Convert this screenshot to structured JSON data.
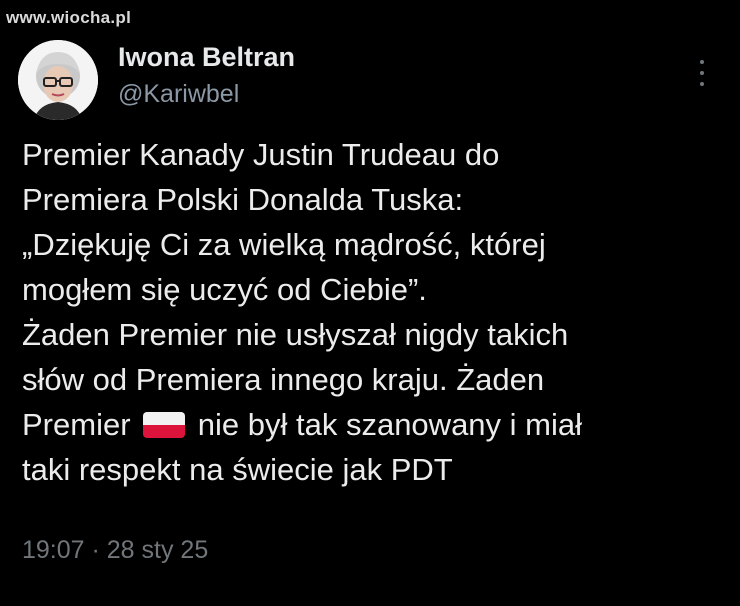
{
  "watermark": "www.wiocha.pl",
  "author": {
    "name": "Iwona Beltran",
    "handle": "@Kariwbel"
  },
  "tweet": {
    "line1": "Premier Kanady Justin Trudeau do",
    "line2": "Premiera Polski Donalda Tuska:",
    "line3": "„Dziękuję Ci za wielką mądrość, której",
    "line4": "mogłem się uczyć od Ciebie”.",
    "line5": "Żaden Premier nie usłyszał nigdy takich",
    "line6": "słów od Premiera innego kraju. Żaden",
    "line7_before_flag": "Premier",
    "line7_after_flag": "nie był tak szanowany i miał",
    "line8": "taki respekt na świecie jak PDT",
    "flag_icon": "poland-flag-icon"
  },
  "meta": {
    "time": "19:07 · 28 sty 25"
  },
  "icons": {
    "more": "more-options-icon",
    "avatar": "avatar"
  },
  "colors": {
    "background": "#000000",
    "text": "#e7e9ea",
    "secondary": "#8b98a5",
    "flag_red": "#dc143c",
    "flag_white": "#f2f2f2"
  }
}
